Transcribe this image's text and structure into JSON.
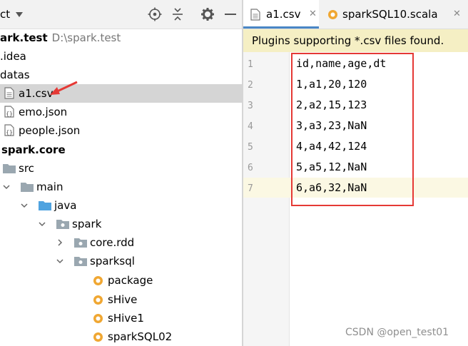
{
  "project_panel": {
    "title": "ct",
    "toolbar_icons": [
      "target-icon",
      "collapse-icon",
      "gear-icon",
      "minimize-icon"
    ]
  },
  "tree": [
    {
      "label": "ark.test",
      "path": "D:\\spark.test",
      "bold": true,
      "icon": "none",
      "indent": 0
    },
    {
      "label": ".idea",
      "icon": "none",
      "indent": 0
    },
    {
      "label": "datas",
      "icon": "none",
      "indent": 0
    },
    {
      "label": "a1.csv",
      "icon": "file-icon",
      "indent": 1,
      "selected": true
    },
    {
      "label": "emo.json",
      "icon": "json-file-icon",
      "indent": 1
    },
    {
      "label": "people.json",
      "icon": "json-file-icon",
      "indent": 1
    },
    {
      "label": "spark.core",
      "bold": true,
      "icon": "none",
      "indent": 0
    },
    {
      "label": "src",
      "icon": "folder-icon",
      "indent": 0
    },
    {
      "label": "main",
      "icon": "folder-icon",
      "arrow": "down",
      "indent": 1
    },
    {
      "label": "java",
      "icon": "source-folder-icon",
      "arrow": "down",
      "indent": 2
    },
    {
      "label": "spark",
      "icon": "package-icon",
      "arrow": "down",
      "indent": 3
    },
    {
      "label": "core.rdd",
      "icon": "package-icon",
      "arrow": "right",
      "indent": 4
    },
    {
      "label": "sparksql",
      "icon": "package-icon",
      "arrow": "down",
      "indent": 4
    },
    {
      "label": "package",
      "icon": "scala-object-icon",
      "indent": 5
    },
    {
      "label": "sHive",
      "icon": "scala-object-icon",
      "indent": 5
    },
    {
      "label": "sHive1",
      "icon": "scala-object-icon",
      "indent": 5
    },
    {
      "label": "sparkSQL02",
      "icon": "scala-object-icon",
      "indent": 5
    }
  ],
  "tabs": [
    {
      "label": "a1.csv",
      "active": true,
      "icon": "file-icon"
    },
    {
      "label": "sparkSQL10.scala",
      "active": false,
      "icon": "scala-object-icon"
    }
  ],
  "banner": {
    "text": "Plugins supporting *.csv files found."
  },
  "editor": {
    "lines": [
      {
        "no": "1",
        "text": "id,name,age,dt"
      },
      {
        "no": "2",
        "text": "1,a1,20,120"
      },
      {
        "no": "3",
        "text": "2,a2,15,123"
      },
      {
        "no": "4",
        "text": "3,a3,23,NaN"
      },
      {
        "no": "5",
        "text": "4,a4,42,124"
      },
      {
        "no": "6",
        "text": "5,a5,12,NaN"
      },
      {
        "no": "7",
        "text": "6,a6,32,NaN"
      }
    ],
    "current_line": 7
  },
  "colors": {
    "selection": "#d5d5d5",
    "annotation": "#e53935",
    "banner_bg": "#f5efc4",
    "folder": "#9aa7b0",
    "source_folder": "#4fa3e0",
    "scala_object": "#f0a732"
  },
  "watermark": "CSDN @open_test01"
}
